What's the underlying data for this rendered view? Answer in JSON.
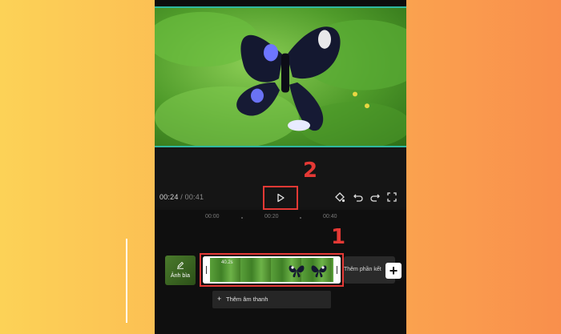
{
  "player": {
    "current_time": "00:24",
    "separator": "/",
    "total_time": "00:41",
    "play_icon": "play-icon"
  },
  "toolbar": {
    "icons": [
      "keyframe-icon",
      "undo-icon",
      "redo-icon",
      "fullscreen-icon"
    ]
  },
  "callouts": {
    "play": "2",
    "clip": "1"
  },
  "timeline": {
    "ruler_labels": [
      "00:00",
      "00:20",
      "00:40"
    ],
    "cover_label": "Ảnh bìa",
    "clip_duration": "40.2s",
    "add_end_label": "Thêm phần kết",
    "add_clip_symbol": "+",
    "audio_plus": "+",
    "audio_label": "Thêm âm thanh"
  },
  "colors": {
    "highlight": "#e53935",
    "preview_border": "#2fb8a0",
    "background_left": "#fcd257",
    "background_right": "#f98f4c"
  }
}
